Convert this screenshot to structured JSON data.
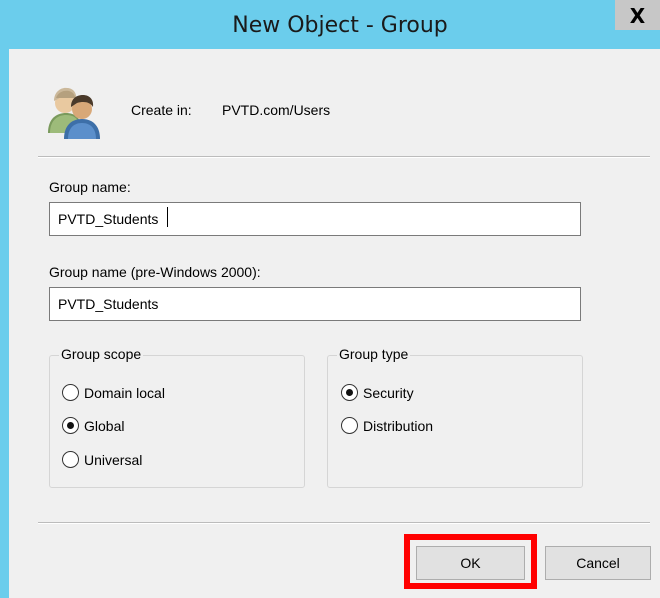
{
  "window": {
    "title": "New Object - Group",
    "close_glyph": "X"
  },
  "create_in": {
    "label": "Create in:",
    "path": "PVTD.com/Users",
    "icon": "users-icon"
  },
  "group_name": {
    "label": "Group name:",
    "value": "PVTD_Students"
  },
  "group_name_pre2000": {
    "label": "Group name (pre-Windows 2000):",
    "value": "PVTD_Students"
  },
  "group_scope": {
    "legend": "Group scope",
    "options": [
      {
        "label": "Domain local",
        "checked": false
      },
      {
        "label": "Global",
        "checked": true
      },
      {
        "label": "Universal",
        "checked": false
      }
    ]
  },
  "group_type": {
    "legend": "Group type",
    "options": [
      {
        "label": "Security",
        "checked": true
      },
      {
        "label": "Distribution",
        "checked": false
      }
    ]
  },
  "buttons": {
    "ok": "OK",
    "cancel": "Cancel"
  },
  "colors": {
    "titlebar": "#6bcdec",
    "highlight": "#ff0000",
    "dialog_bg": "#f0f0f0"
  }
}
